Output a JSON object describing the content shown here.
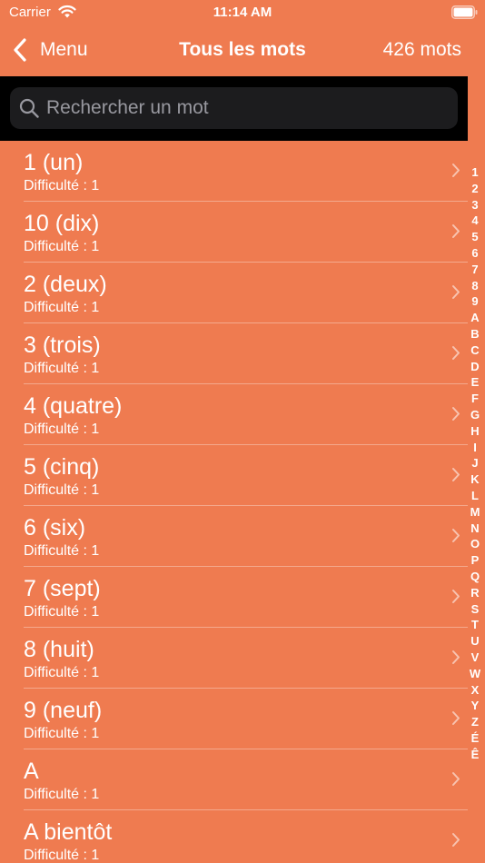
{
  "status_bar": {
    "carrier": "Carrier",
    "time": "11:14 AM"
  },
  "nav": {
    "back_label": "Menu",
    "title": "Tous les mots",
    "count": "426 mots"
  },
  "search": {
    "placeholder": "Rechercher un mot"
  },
  "words": [
    {
      "title": "1 (un)",
      "subtitle": "Difficulté : 1"
    },
    {
      "title": "10 (dix)",
      "subtitle": "Difficulté : 1"
    },
    {
      "title": "2 (deux)",
      "subtitle": "Difficulté : 1"
    },
    {
      "title": "3 (trois)",
      "subtitle": "Difficulté : 1"
    },
    {
      "title": "4 (quatre)",
      "subtitle": "Difficulté : 1"
    },
    {
      "title": "5 (cinq)",
      "subtitle": "Difficulté : 1"
    },
    {
      "title": "6 (six)",
      "subtitle": "Difficulté : 1"
    },
    {
      "title": "7 (sept)",
      "subtitle": "Difficulté : 1"
    },
    {
      "title": "8 (huit)",
      "subtitle": "Difficulté : 1"
    },
    {
      "title": "9 (neuf)",
      "subtitle": "Difficulté : 1"
    },
    {
      "title": "A",
      "subtitle": "Difficulté : 1"
    },
    {
      "title": "A bientôt",
      "subtitle": "Difficulté : 1"
    }
  ],
  "section_index": [
    "1",
    "2",
    "3",
    "4",
    "5",
    "6",
    "7",
    "8",
    "9",
    "A",
    "B",
    "C",
    "D",
    "E",
    "F",
    "G",
    "H",
    "I",
    "J",
    "K",
    "L",
    "M",
    "N",
    "O",
    "P",
    "Q",
    "R",
    "S",
    "T",
    "U",
    "V",
    "W",
    "X",
    "Y",
    "Z",
    "É",
    "Ê"
  ],
  "colors": {
    "background": "#EF7B50",
    "search_area": "#000000",
    "search_field": "#1C1C1E",
    "placeholder": "#98989F",
    "text": "#FFFFFF"
  },
  "icons": {
    "back": "chevron-left-icon",
    "search": "magnifying-glass-icon",
    "row": "chevron-right-icon",
    "wifi": "wifi-icon",
    "battery": "battery-icon"
  }
}
